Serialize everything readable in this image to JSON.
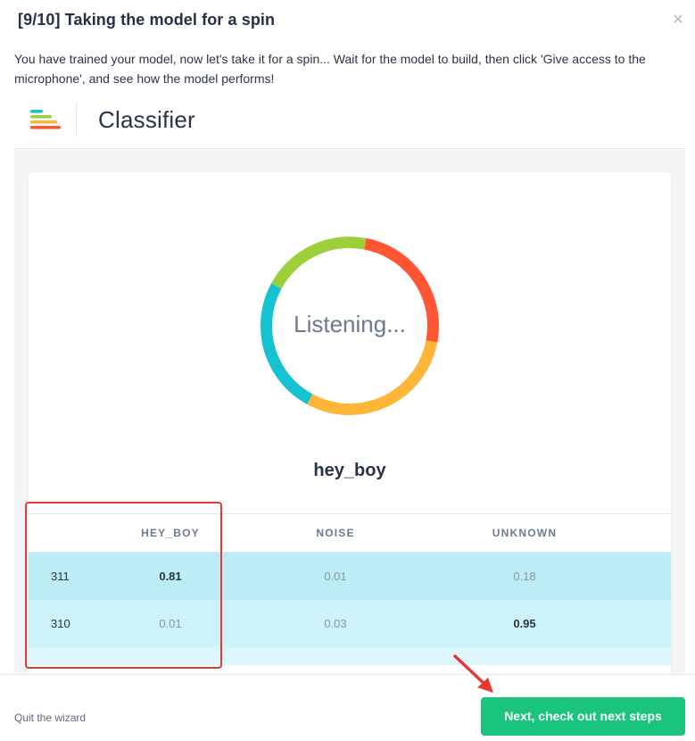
{
  "modal": {
    "title": "[9/10] Taking the model for a spin",
    "close_icon": "close-icon",
    "intro": "You have trained your model, now let's take it for a spin... Wait for the model to build, then click 'Give access to the microphone', and see how the model performs!"
  },
  "classifier": {
    "logo_icon": "classifier-logo-icon",
    "name": "Classifier",
    "status": "Listening...",
    "ring_colors": [
      "#9ccf3a",
      "#ff5533",
      "#ffb535",
      "#16c1d0"
    ],
    "prediction": "hey_boy"
  },
  "table": {
    "headers": [
      "",
      "HEY_BOY",
      "NOISE",
      "UNKNOWN"
    ],
    "rows": [
      {
        "index": "311",
        "hey_boy": "0.81",
        "noise": "0.01",
        "unknown": "0.18"
      },
      {
        "index": "310",
        "hey_boy": "0.01",
        "noise": "0.03",
        "unknown": "0.95"
      }
    ]
  },
  "annotations": {
    "highlight_color": "#e53935",
    "arrow_icon": "red-arrow-icon"
  },
  "footer": {
    "quit_label": "Quit the wizard",
    "next_label": "Next, check out next steps",
    "next_color": "#1bc47d"
  }
}
